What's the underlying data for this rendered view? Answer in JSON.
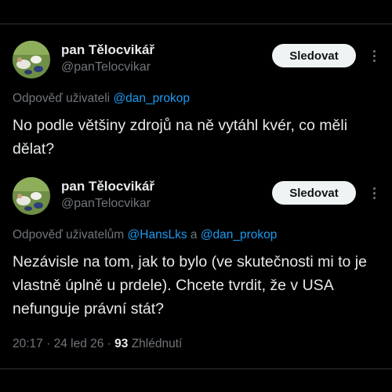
{
  "tweets": [
    {
      "author_name": "pan Tělocvikář",
      "author_handle": "@panTelocvikar",
      "follow_label": "Sledovat",
      "reply_prefix": "Odpověď uživateli ",
      "reply_mention_1": "@dan_prokop",
      "text": "No podle většiny zdrojů na ně vytáhl kvér, co měli dělat?"
    },
    {
      "author_name": "pan Tělocvikář",
      "author_handle": "@panTelocvikar",
      "follow_label": "Sledovat",
      "reply_prefix": "Odpověď uživatelům ",
      "reply_mention_1": "@HansLks",
      "reply_joiner": " a ",
      "reply_mention_2": "@dan_prokop",
      "text": "Nezávisle na tom, jak to bylo (ve skutečnosti mi to je vlastně úplně u prdele). Chcete tvrdit, že v USA nefunguje právní stát?",
      "time": "20:17",
      "separator_1": " · ",
      "date": "24 led 26",
      "separator_2": " · ",
      "views_count": "93",
      "views_label": " Zhlédnutí"
    }
  ],
  "colors": {
    "background": "#000000",
    "text_primary": "#e7e9ea",
    "text_secondary": "#71767b",
    "link": "#1d9bf0",
    "divider": "#2f3336",
    "follow_bg": "#eff3f4"
  },
  "icons": {
    "more": "more-options-icon"
  }
}
